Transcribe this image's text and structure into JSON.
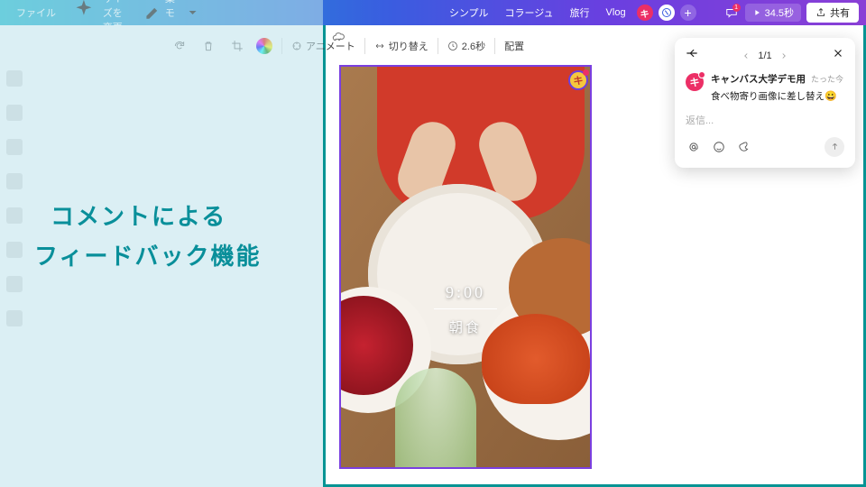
{
  "topbar": {
    "menu_file": "ファイル",
    "resize": "サイズを変更",
    "edit_mode": "編集モード",
    "styles": [
      "シンプル",
      "コラージュ",
      "旅行",
      "Vlog"
    ],
    "badge_letter": "キ",
    "notif_count": "1",
    "play_duration": "34.5秒",
    "share": "共有"
  },
  "toolbar": {
    "animate": "アニメート",
    "transition": "切り替え",
    "duration": "2.6秒",
    "position": "配置"
  },
  "headline": {
    "line1": "コメントによる",
    "line2": "フィードバック機能"
  },
  "canvas_overlay": {
    "time": "9:00",
    "label": "朝食"
  },
  "pin_letter": "キ",
  "panel": {
    "page": "1/1",
    "avatar_letter": "キ",
    "author": "キャンバス大学デモ用",
    "timestamp": "たった今",
    "comment_text": "食べ物寄り画像に差し替え",
    "comment_emoji": "😀",
    "reply_placeholder": "返信..."
  }
}
